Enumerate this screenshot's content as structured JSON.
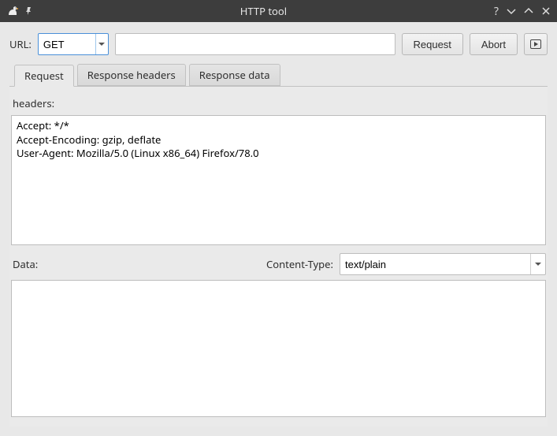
{
  "window": {
    "title": "HTTP tool"
  },
  "url_row": {
    "label": "URL:",
    "method": "GET",
    "url_value": "",
    "request_btn": "Request",
    "abort_btn": "Abort"
  },
  "tabs": {
    "request": "Request",
    "response_headers": "Response headers",
    "response_data": "Response data"
  },
  "request_tab": {
    "headers_label": "headers:",
    "headers_value": "Accept: */*\nAccept-Encoding: gzip, deflate\nUser-Agent: Mozilla/5.0 (Linux x86_64) Firefox/78.0",
    "data_label": "Data:",
    "content_type_label": "Content-Type:",
    "content_type_value": "text/plain",
    "data_value": ""
  }
}
